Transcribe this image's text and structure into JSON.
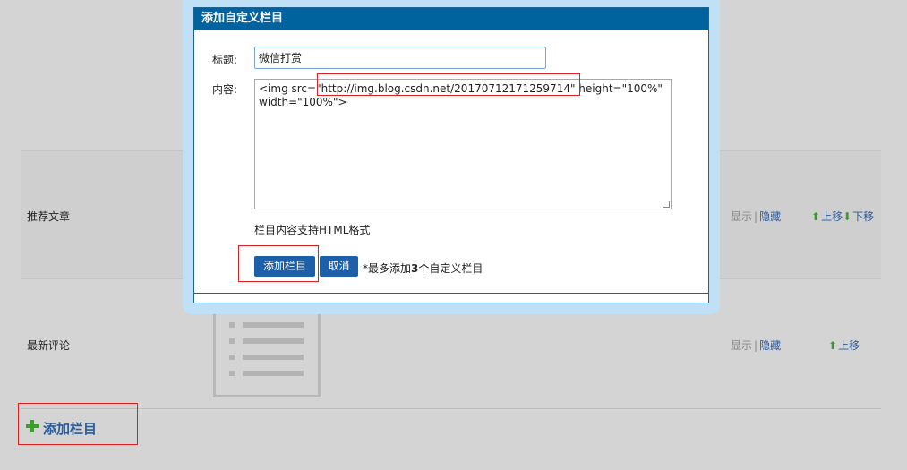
{
  "rows": [
    {
      "title": "推荐文章",
      "show": "显示",
      "sep": "|",
      "hide": "隐藏",
      "up": "上移",
      "down": "下移"
    },
    {
      "title": "最新评论",
      "show": "显示",
      "sep": "|",
      "hide": "隐藏",
      "up": "上移"
    }
  ],
  "add_column": {
    "label": "添加栏目",
    "icon": "plus-icon"
  },
  "modal": {
    "title": "添加自定义栏目",
    "title_label": "标题:",
    "title_value": "微信打赏",
    "content_label": "内容:",
    "content_value": "<img src=\"http://img.blog.csdn.net/20170712171259714\" height=\"100%\" width=\"100%\">",
    "hint": "栏目内容支持HTML格式",
    "add_button": "添加栏目",
    "cancel_button": "取消",
    "note_prefix": "*最多添加",
    "note_count": "3",
    "note_suffix": "个自定义栏目"
  },
  "colors": {
    "header": "#00639e",
    "button": "#1d5fa8",
    "link": "#2a5b9a",
    "highlight": "#e02020",
    "arrow": "#3a9a2a"
  }
}
